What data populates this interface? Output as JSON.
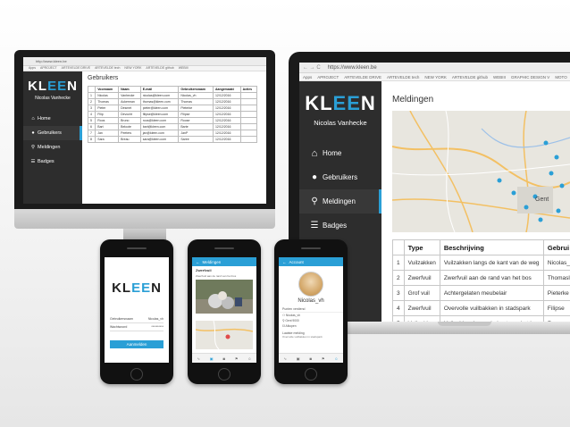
{
  "brand": {
    "logo_main": "KL",
    "logo_accent": "EE",
    "logo_end": "N",
    "user": "Nicolas Vanhecke"
  },
  "sidebar": {
    "items": [
      {
        "label": "Home",
        "icon": "home-icon"
      },
      {
        "label": "Gebruikers",
        "icon": "users-icon"
      },
      {
        "label": "Meldingen",
        "icon": "map-pin-icon"
      },
      {
        "label": "Badges",
        "icon": "list-icon"
      }
    ]
  },
  "browser": {
    "imac_url": "http://www.kleen.be",
    "laptop_url": "https://www.kleen.be",
    "bookmarks": [
      "Apps",
      "APROJECT",
      "ARTEVELDE DRIVE",
      "ARTEVELDE tech",
      "NEW YORK",
      "ARTEVELDE github",
      "WEBIII",
      "GRAPHIC DESIGN V",
      "MOTO"
    ]
  },
  "imac": {
    "page_title": "Gebruikers",
    "columns": [
      "",
      "Voornaam",
      "Naam",
      "E-mail",
      "Gebruikersnaam",
      "Aangemaakt",
      "Acties"
    ],
    "rows": [
      [
        "1",
        "Nicolas",
        "Vanhecke",
        "nicolas@kleen.com",
        "Nicolas_vh",
        "12/12/2016",
        ""
      ],
      [
        "2",
        "Thomas",
        "Ackerman",
        "thomas@kleen.com",
        "Thomas",
        "12/12/2016",
        ""
      ],
      [
        "3",
        "Pieter",
        "Desmet",
        "pieter@kleen.com",
        "Pieterke",
        "12/12/2016",
        ""
      ],
      [
        "4",
        "Filip",
        "Devocht",
        "filipse@kleen.com",
        "Filipse",
        "12/12/2016",
        ""
      ],
      [
        "5",
        "Roos",
        "Bruno",
        "roos@kleen.com",
        "Roose",
        "12/12/2016",
        ""
      ],
      [
        "6",
        "Bart",
        "Beloote",
        "bart@kleen.com",
        "Barte",
        "12/12/2016",
        ""
      ],
      [
        "7",
        "Jan",
        "Peeters",
        "jan@kleen.com",
        "JanP",
        "12/12/2016",
        ""
      ],
      [
        "8",
        "Sara",
        "Breau",
        "sara@kleen.com",
        "Saree",
        "12/12/2016",
        ""
      ]
    ]
  },
  "laptop": {
    "page_title": "Meldingen",
    "columns": [
      "",
      "Type",
      "Beschrijving",
      "Gebrui"
    ],
    "rows": [
      [
        "1",
        "Vuilzakken",
        "Vuilzakken langs de kant van de weg",
        "Nicolas_"
      ],
      [
        "2",
        "Zwerfvuil",
        "Zwerfvuil aan de rand van het bos",
        "Thomasl"
      ],
      [
        "3",
        "Grof vuil",
        "Achtergelaten meubelair",
        "Pieterke"
      ],
      [
        "4",
        "Zwerfvuil",
        "Overvolle vuilbakken in stadspark",
        "Filipse"
      ],
      [
        "5",
        "Vuilzakken",
        "Vuilzakken langs de kant van het bos",
        "Roose"
      ]
    ],
    "map_labels": [
      "Gent"
    ]
  },
  "phone1": {
    "field1_label": "Gebruikersnaam",
    "field1_value": "Nicolas_vh",
    "field2_label": "Wachtwoord",
    "field2_value": "**********",
    "button": "Aanmelden"
  },
  "phone2": {
    "title": "Meldingen",
    "section": "Zwerfvuil",
    "caption": "Zwerfvuil aan de rand van het bos"
  },
  "phone3": {
    "title": "Account",
    "username": "Nicolas_vh",
    "section": "Punten verdiend",
    "stats": [
      "Nicolas_vh",
      "Gent 9000",
      "Afkopen"
    ],
    "footer": "Laatste melding",
    "footer_item": "Overvolle vuilbakken in stadspark"
  },
  "colors": {
    "accent": "#2a9fd6",
    "sidebar": "#2d2d2d"
  }
}
